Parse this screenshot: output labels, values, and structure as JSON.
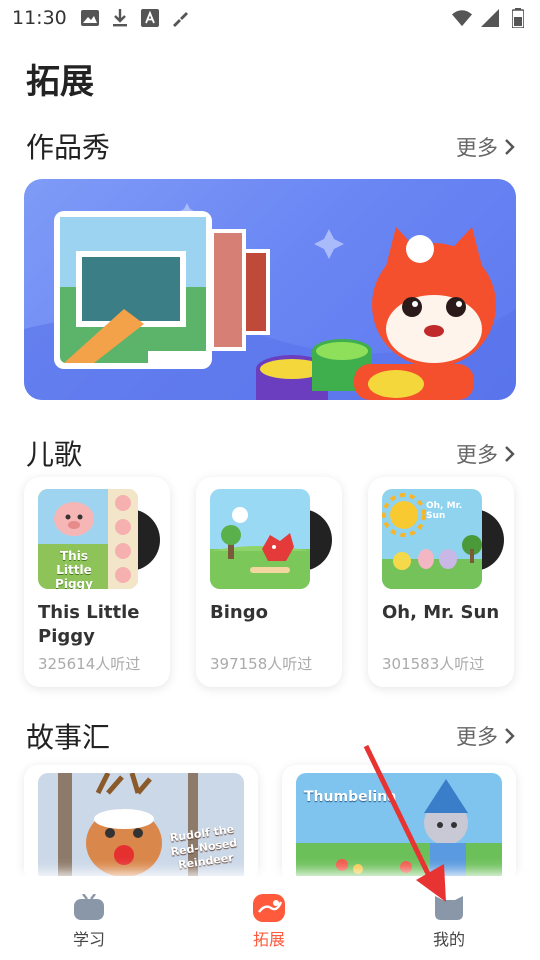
{
  "status_bar": {
    "time": "11:30"
  },
  "page_title": "拓展",
  "sections": {
    "showcase": {
      "title": "作品秀",
      "more": "更多"
    },
    "songs": {
      "title": "儿歌",
      "more": "更多",
      "items": [
        {
          "title": "This Little Piggy",
          "count": "325614人听过"
        },
        {
          "title": "Bingo",
          "count": "397158人听过"
        },
        {
          "title": "Oh, Mr. Sun",
          "count": "301583人听过"
        }
      ]
    },
    "stories": {
      "title": "故事汇",
      "more": "更多",
      "items": [
        {
          "cover_text": "Rudolf the Red-Nosed Reindeer"
        },
        {
          "cover_text": "Thumbelina"
        }
      ]
    }
  },
  "song_cover_texts": {
    "piggy": "This Little Piggy",
    "sun": "Oh, Mr. Sun"
  },
  "tab_bar": {
    "tabs": [
      {
        "label": "学习",
        "icon": "tv-icon"
      },
      {
        "label": "拓展",
        "icon": "chat-icon",
        "active": true
      },
      {
        "label": "我的",
        "icon": "profile-icon"
      }
    ]
  },
  "colors": {
    "accent": "#ff5a3c",
    "banner": "#6a86f3"
  }
}
